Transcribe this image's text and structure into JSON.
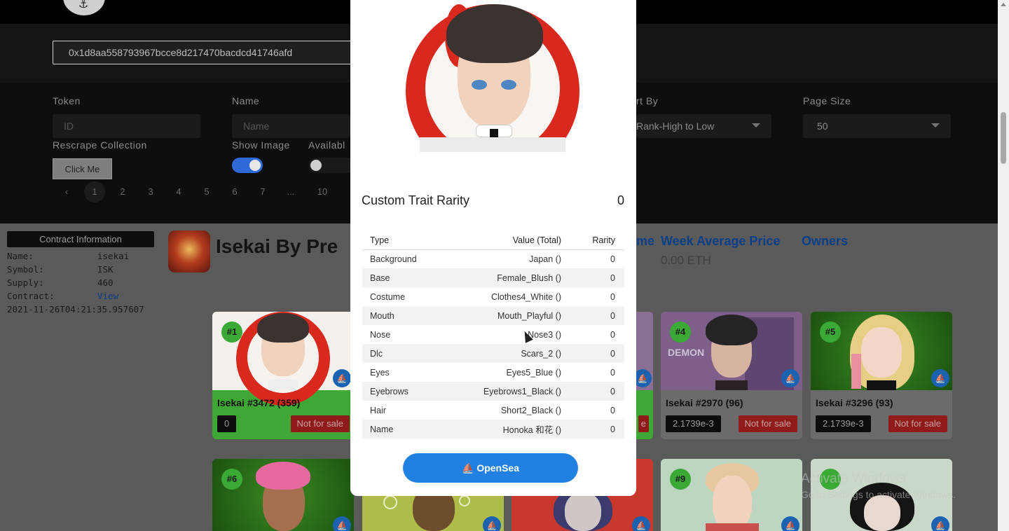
{
  "header": {
    "logo_icon": "ship-logo-icon"
  },
  "search": {
    "contract_address": "0x1d8aa558793967bcce8d217470bacdcd41746afd"
  },
  "filters": {
    "token_label": "Token",
    "token_placeholder": "ID",
    "name_label": "Name",
    "name_placeholder": "Name",
    "sort_label": "rt By",
    "sort_value": "Rank-High to Low",
    "page_size_label": "Page Size",
    "page_size_value": "50",
    "rescrape_label": "Rescrape Collection",
    "click_me": "Click Me",
    "show_image_label": "Show Image",
    "show_image_on": true,
    "available_label": "Availabl",
    "available_on": false
  },
  "pagination": {
    "prev": "‹",
    "pages": [
      "1",
      "2",
      "3",
      "4",
      "5",
      "6",
      "7",
      "...",
      "10"
    ],
    "active": "1"
  },
  "contract": {
    "header": "Contract Information",
    "rows": [
      {
        "key": "Name:",
        "value": "isekai"
      },
      {
        "key": "Symbol:",
        "value": "ISK"
      },
      {
        "key": "Supply:",
        "value": "460"
      },
      {
        "key": "Contract:",
        "value": "View"
      }
    ],
    "timestamp": "2021-11-26T04:21:35.957607"
  },
  "collection": {
    "title": "Isekai By Pre",
    "stat_fragment": "me",
    "week_avg_label": "Week Average Price",
    "owners_label": "Owners",
    "week_avg_value": "0.00 ETH"
  },
  "cards": [
    {
      "rank": "#1",
      "name": "Isekai #3472 (359)",
      "price": "0",
      "sale": "Not for sale",
      "bg": "#3ea735"
    },
    {
      "rank": "#4",
      "name": "Isekai #2970 (96)",
      "price": "2.1739e-3",
      "sale": "Not for sale",
      "bg": "#8c8c8c"
    },
    {
      "rank": "#5",
      "name": "Isekai #3296 (93)",
      "price": "2.1739e-3",
      "sale": "Not for sale",
      "bg": "#8c8c8c"
    },
    {
      "rank": "#6"
    },
    {
      "rank": "#9"
    }
  ],
  "card_fragments": {
    "sale_fragment": "e",
    "demon_text": "DEMON"
  },
  "modal": {
    "title": "Custom Trait Rarity",
    "score": "0",
    "columns": [
      "Type",
      "Value (Total)",
      "Rarity"
    ],
    "traits": [
      {
        "type": "Background",
        "value": "Japan ()",
        "rarity": "0"
      },
      {
        "type": "Base",
        "value": "Female_Blush ()",
        "rarity": "0"
      },
      {
        "type": "Costume",
        "value": "Clothes4_White ()",
        "rarity": "0"
      },
      {
        "type": "Mouth",
        "value": "Mouth_Playful ()",
        "rarity": "0"
      },
      {
        "type": "Nose",
        "value": "Nose3 ()",
        "rarity": "0"
      },
      {
        "type": "Dlc",
        "value": "Scars_2 ()",
        "rarity": "0"
      },
      {
        "type": "Eyes",
        "value": "Eyes5_Blue ()",
        "rarity": "0"
      },
      {
        "type": "Eyebrows",
        "value": "Eyebrows1_Black ()",
        "rarity": "0"
      },
      {
        "type": "Hair",
        "value": "Short2_Black ()",
        "rarity": "0"
      },
      {
        "type": "Name",
        "value": "Honoka 和花 ()",
        "rarity": "0"
      }
    ],
    "opensea_label": "OpenSea",
    "opensea_icon": "opensea-ship-icon"
  },
  "watermark": {
    "line1": "Activate Windows",
    "line2": "Go to Settings to activate Windows."
  },
  "colors": {
    "accent_blue": "#2081e2",
    "header_blue": "#0a3f8a",
    "rank_green": "#3aa935",
    "sale_red": "#8f1b1b"
  }
}
